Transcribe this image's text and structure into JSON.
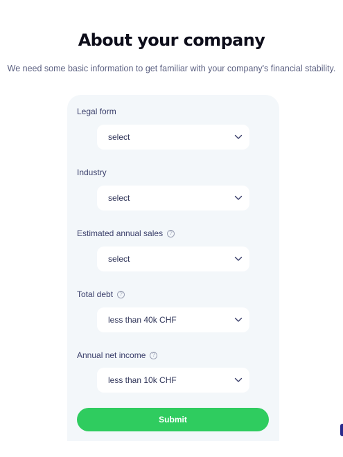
{
  "header": {
    "title": "About your company",
    "subtitle": "We need some basic information to get familiar with your company's financial stability."
  },
  "form": {
    "fields": [
      {
        "label": "Legal form",
        "value": "select",
        "has_info": false
      },
      {
        "label": "Industry",
        "value": "select",
        "has_info": false
      },
      {
        "label": "Estimated annual sales",
        "value": "select",
        "has_info": true
      },
      {
        "label": "Total debt",
        "value": "less than 40k CHF",
        "has_info": true
      },
      {
        "label": "Annual net income",
        "value": "less than 10k CHF",
        "has_info": true
      }
    ],
    "submit_label": "Submit"
  },
  "icons": {
    "info": "info-icon",
    "chevron": "chevron-down-icon"
  },
  "colors": {
    "card_background": "#f3f7fa",
    "submit_button": "#2fcc5f",
    "title": "#0d0d1a",
    "text": "#3a3f6b"
  }
}
